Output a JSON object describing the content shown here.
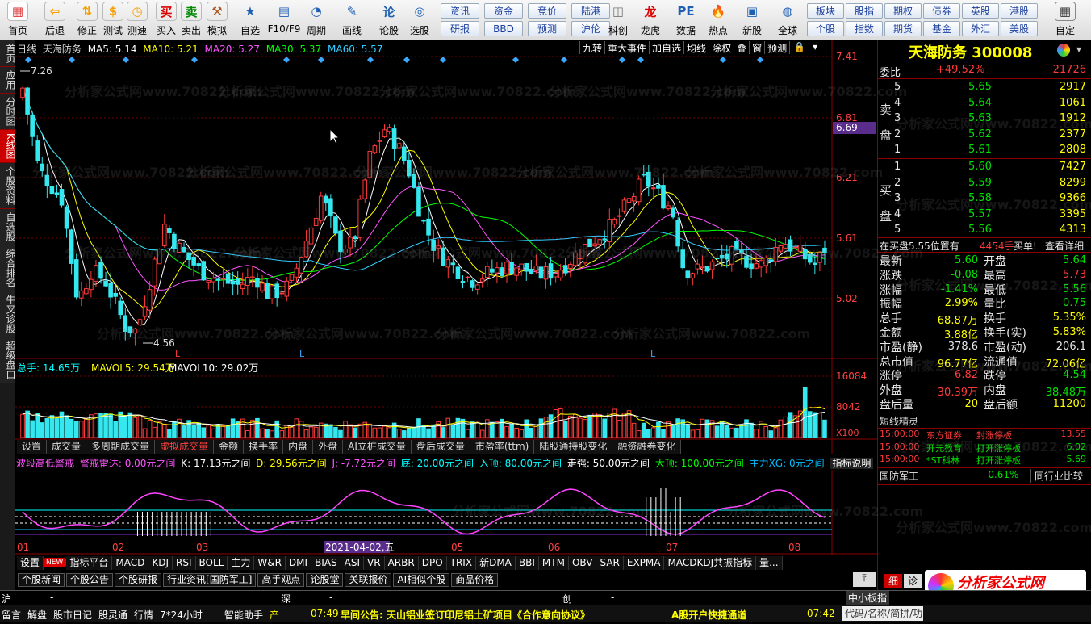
{
  "toolbar": {
    "items": [
      {
        "name": "home-button",
        "label": "首页",
        "icon": "windows-logo"
      },
      {
        "name": "back-button",
        "label": "后退",
        "icon": "arrow-left"
      },
      {
        "name": "revise-button",
        "label": "修正",
        "icon": "arrows-up-down"
      },
      {
        "name": "backtest-button",
        "label": "测试",
        "icon": "dollar-circle"
      },
      {
        "name": "timer-button",
        "label": "测速",
        "icon": "clock"
      },
      {
        "name": "buy-button",
        "label": "买入",
        "icon": "buy-char"
      },
      {
        "name": "sell-button",
        "label": "卖出",
        "icon": "sell-char"
      },
      {
        "name": "simulate-button",
        "label": "模拟",
        "icon": "hammer"
      },
      {
        "name": "watchlist-button",
        "label": "自选",
        "icon": "star"
      },
      {
        "name": "f10-button",
        "label": "F10/F9",
        "icon": "document"
      },
      {
        "name": "period-button",
        "label": "周期",
        "icon": "clock-cycle"
      },
      {
        "name": "draw-button",
        "label": "画线",
        "icon": "pencil"
      },
      {
        "name": "forum-button",
        "label": "论股",
        "icon": "forum-logo"
      },
      {
        "name": "select-stock-button",
        "label": "选股",
        "icon": "chart-search"
      }
    ],
    "grid": [
      [
        "资讯",
        "资金",
        "竞价",
        "陆港"
      ],
      [
        "研报",
        "BBD",
        "预测",
        "沪伦"
      ]
    ],
    "items2": [
      {
        "name": "kechuang-button",
        "label": "科创",
        "icon": "kechuang"
      },
      {
        "name": "dragon-button",
        "label": "龙虎",
        "icon": "dragon"
      },
      {
        "name": "data-button",
        "label": "数据",
        "icon": "pe"
      },
      {
        "name": "hot-button",
        "label": "热点",
        "icon": "hot"
      },
      {
        "name": "new-stock-button",
        "label": "新股",
        "icon": "new-stock"
      },
      {
        "name": "global-button",
        "label": "全球",
        "icon": "globe"
      }
    ],
    "grid2": [
      [
        "板块",
        "股指",
        "期权",
        "债券",
        "英股",
        "港股"
      ],
      [
        "个股",
        "指数",
        "期货",
        "基金",
        "外汇",
        "美股"
      ]
    ],
    "custom": "自定"
  },
  "left_tabs": [
    "首页",
    "应用",
    "分时图",
    "K线图",
    "个股资料",
    "自选股",
    "综合排名",
    "牛叉诊股",
    "超级盘口"
  ],
  "chart": {
    "period": "日线",
    "stock": "天海防务",
    "ma5": "MA5: 5.14",
    "ma10": "MA10: 5.21",
    "ma20": "MA20: 5.27",
    "ma30": "MA30: 5.37",
    "ma60": "MA60: 5.57",
    "buttons": [
      "九转",
      "重大事件",
      "加自选",
      "均线",
      "除权",
      "叠",
      "窗",
      "预测"
    ],
    "yticks": [
      "7.41",
      "6.81",
      "6.21",
      "5.61",
      "5.02"
    ],
    "price_tag": "6.69",
    "high": "7.26",
    "low": "4.56",
    "lmark": "L",
    "vol_label": "总手: 14.65万",
    "mavol5": "MAVOL5: 29.54万",
    "mavol10": "MAVOL10: 29.02万",
    "vol_ticks": [
      "16084",
      "8042",
      "X100"
    ]
  },
  "tabs1": [
    "设置",
    "成交量",
    "多周期成交量",
    "虚拟成交量",
    "金额",
    "换手率",
    "内盘",
    "外盘",
    "AI立桩成交量",
    "盘后成交量",
    "市盈率(ttm)",
    "陆股通持股变化",
    "融资融券变化"
  ],
  "ind": {
    "title": "波段高低警戒",
    "alarm": "警戒雷达: 0.00元之间",
    "k": "K: 17.13元之间",
    "d": "D: 29.56元之间",
    "j": "J: -7.72元之间",
    "bottom": "底: 20.00元之间",
    "entry": "入顶: 80.00元之间",
    "mid": "走强: 50.00元之间",
    "top": "大顶: 100.00元之间",
    "xg": "主力XG: 0元之间",
    "help": "指标说明"
  },
  "x_axis": [
    "01",
    "02",
    "03",
    "2021-04-02,五",
    "05",
    "06",
    "07",
    "08"
  ],
  "tabs2": [
    "设置",
    "NEW",
    "指标平台",
    "MACD",
    "KDJ",
    "RSI",
    "BOLL",
    "主力",
    "W&R",
    "DMI",
    "BIAS",
    "ASI",
    "VR",
    "ARBR",
    "DPO",
    "TRIX",
    "新DMA",
    "BBI",
    "MTM",
    "OBV",
    "SAR",
    "EXPMA",
    "MACDKDJ共振指标",
    "量..."
  ],
  "tabs3": [
    "个股新闻",
    "个股公告",
    "个股研报",
    "行业资讯[国防军工]",
    "高手观点",
    "论股堂",
    "关联报价",
    "AI相似个股",
    "商品价格"
  ],
  "quote": {
    "title": "天海防务 300008",
    "weibi_label": "委比",
    "weibi": "+49.52%",
    "weicha": "21726",
    "sells": [
      [
        "5",
        "5.65",
        "2917"
      ],
      [
        "4",
        "5.64",
        "1061"
      ],
      [
        "3",
        "5.63",
        "1912"
      ],
      [
        "2",
        "5.62",
        "2377"
      ],
      [
        "1",
        "5.61",
        "2808"
      ]
    ],
    "buys": [
      [
        "1",
        "5.60",
        "7427"
      ],
      [
        "2",
        "5.59",
        "8299"
      ],
      [
        "3",
        "5.58",
        "9366"
      ],
      [
        "4",
        "5.57",
        "3395"
      ],
      [
        "5",
        "5.56",
        "4313"
      ]
    ],
    "sell_label": "卖盘",
    "buy_label": "买盘",
    "alert": "在买盘5.55位置有",
    "alert_vol": "4454手",
    "alert_act": "买单!",
    "alert_more": "查看详细",
    "stats": [
      [
        "最新",
        "5.60",
        "开盘",
        "5.64",
        "g",
        "g"
      ],
      [
        "涨跌",
        "-0.08",
        "最高",
        "5.73",
        "g",
        "r"
      ],
      [
        "涨幅",
        "-1.41%",
        "最低",
        "5.56",
        "g",
        "g"
      ],
      [
        "振幅",
        "2.99%",
        "量比",
        "0.75",
        "y",
        "g"
      ],
      [
        "总手",
        "68.87万",
        "换手",
        "5.35%",
        "y",
        "y"
      ],
      [
        "金额",
        "3.88亿",
        "换手(实)",
        "5.83%",
        "y",
        "y"
      ],
      [
        "市盈(静)",
        "378.6",
        "市盈(动)",
        "206.1",
        "w",
        "w"
      ],
      [
        "总市值",
        "96.77亿",
        "流通值",
        "72.06亿",
        "y",
        "y"
      ],
      [
        "涨停",
        "6.82",
        "跌停",
        "4.54",
        "r",
        "g"
      ],
      [
        "外盘",
        "30.39万",
        "内盘",
        "38.48万",
        "r",
        "g"
      ],
      [
        "盘后量",
        "20",
        "盘后额",
        "11200",
        "y",
        "y"
      ]
    ],
    "sprite_title": "短线精灵",
    "sprites": [
      [
        "15:00:00",
        "东方证券",
        "封涨停板",
        "13.55"
      ],
      [
        "15:00:00",
        "开元教育",
        "打开涨停板",
        "6.02"
      ],
      [
        "15:00:00",
        "*ST科林",
        "打开涨停板",
        "5.69"
      ]
    ],
    "sector": "国防军工",
    "sector_pct": "-0.61%",
    "peer": "同行业比较"
  },
  "bottom": {
    "idx_sh": "沪",
    "idx_sz": "深",
    "idx_cy": "创",
    "dash": "-",
    "sme": "中小板指",
    "news_time": "07:49",
    "news": "早间公告: 天山铝业签订印尼铝土矿项目《合作意向协议》",
    "promo": "A股开户快捷通道",
    "clock": "07:42",
    "links": [
      "留言",
      "解盘",
      "股市日记",
      "股灵通",
      "行情",
      "7*24小时",
      "智能助手",
      "产"
    ],
    "search": "代码/名称/简拼/功能",
    "logo": "分析家公式网",
    "logo_url": "www.70822.com",
    "side_tabs": [
      "细",
      "诊"
    ]
  },
  "watermark": "分析家公式网www.70822.com"
}
